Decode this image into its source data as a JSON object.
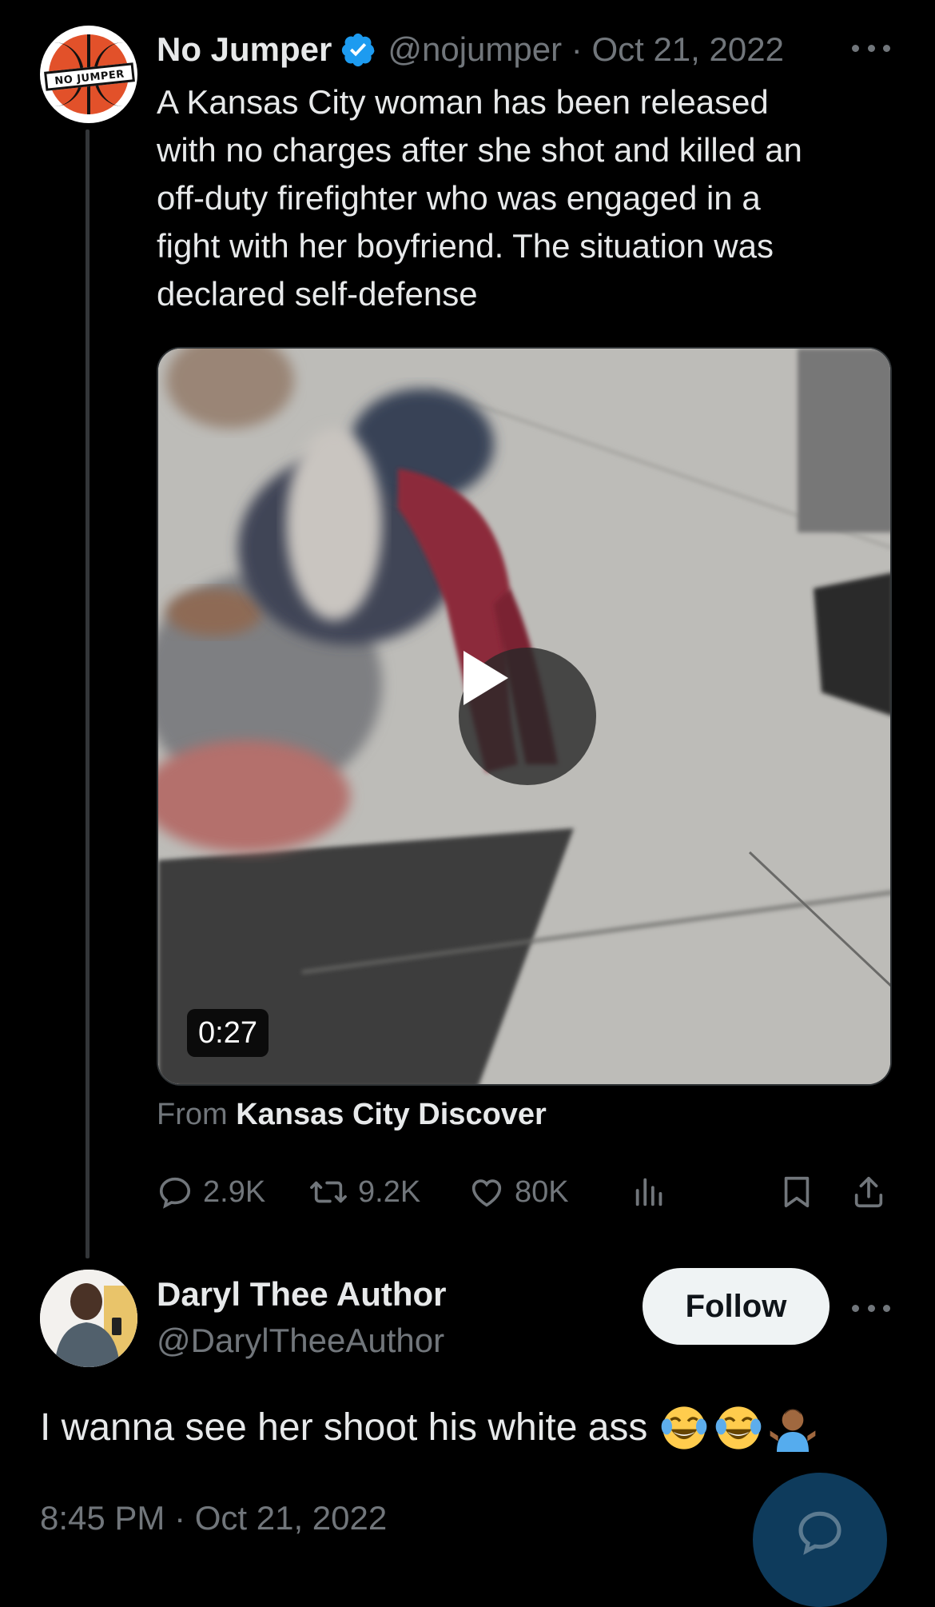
{
  "tweet": {
    "author_name": "No Jumper",
    "handle": "@nojumper",
    "date": "Oct 21, 2022",
    "avatar_label": "NO JUMPER",
    "text": "A Kansas City woman has been released\nwith no charges after she shot and killed an\noff-duty firefighter who was engaged in a\nfight with her boyfriend. The situation was\ndeclared self-defense",
    "video_duration": "0:27",
    "source_prefix": "From",
    "source_name": "Kansas City Discover",
    "stats": {
      "replies": "2.9K",
      "retweets": "9.2K",
      "likes": "80K"
    }
  },
  "reply": {
    "author_name": "Daryl Thee Author",
    "handle": "@DarylTheeAuthor",
    "follow_label": "Follow",
    "text": "I wanna see her shoot his white ass",
    "emojis": [
      "face-with-tears-of-joy",
      "face-with-tears-of-joy",
      "person-shrugging"
    ],
    "timestamp": "8:45 PM · Oct 21, 2022"
  },
  "colors": {
    "background": "#000000",
    "text": "#e7e9ea",
    "muted": "#71767b",
    "verified": "#1d9bf0",
    "fab": "#0e3b5c"
  },
  "icons": [
    "more-icon",
    "verified-badge-icon",
    "play-icon",
    "reply-icon",
    "retweet-icon",
    "like-icon",
    "views-icon",
    "bookmark-icon",
    "share-icon",
    "compose-reply-icon"
  ]
}
